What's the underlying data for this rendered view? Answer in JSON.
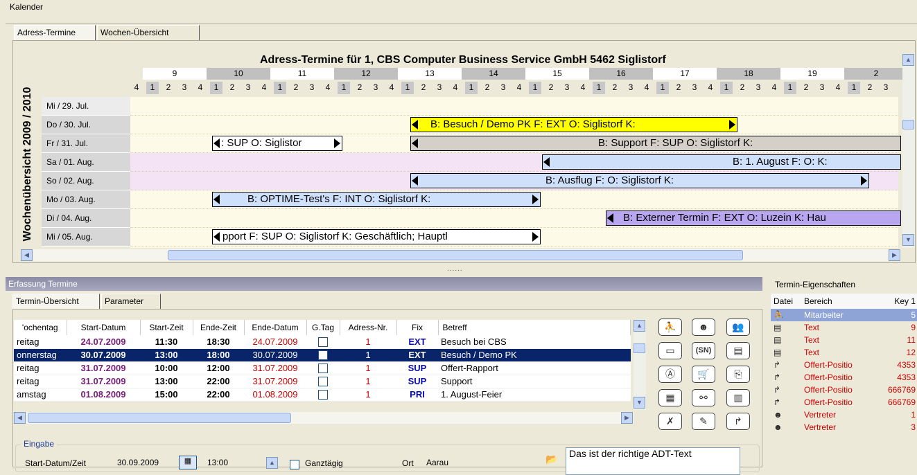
{
  "window": {
    "title": "Kalender"
  },
  "tabs": [
    {
      "label": "Adress-Termine"
    },
    {
      "label": "Wochen-Übersicht"
    }
  ],
  "calendar": {
    "title": "Adress-Termine für 1, CBS Computer Business Service GmbH  5462 Siglistorf",
    "year_label": "Wochenübersicht 2009 / 2010",
    "hours": [
      "9",
      "10",
      "11",
      "12",
      "13",
      "14",
      "15",
      "16",
      "17",
      "18",
      "19",
      "2"
    ],
    "days": [
      "Mi / 29. Jul.",
      "Do / 30. Jul.",
      "Fr / 31. Jul.",
      "Sa / 01. Aug.",
      "So / 02. Aug.",
      "Mo / 03. Aug.",
      "Di / 04. Aug.",
      "Mi / 05. Aug."
    ],
    "events": [
      {
        "text": "B: Besuch / Demo PK F: EXT O: Siglistorf K:",
        "color": "#ffff00"
      },
      {
        "text": ": SUP O: Siglistor",
        "color": "#ffffff"
      },
      {
        "text": "B: Support F: SUP O: Siglistorf K:",
        "color": "#d4d0c8"
      },
      {
        "text": "B: 1. August F:  O:  K:",
        "color": "#cfe0fb"
      },
      {
        "text": "B: Ausflug  F:  O: Siglistorf K:",
        "color": "#cfe0fb"
      },
      {
        "text": "B: OPTIME-Test's F: INT O: Siglistorf K:",
        "color": "#cfe0fb"
      },
      {
        "text": "B: Externer Termin F: EXT O: Luzein K: Hau",
        "color": "#b8a6f0"
      },
      {
        "text": "pport F: SUP O: Siglistorf K: Geschäftlich; Hauptl",
        "color": "#ffffff"
      }
    ]
  },
  "splitter": "......",
  "erfassung": {
    "title": "Erfassung Termine",
    "tabs": [
      {
        "label": "Termin-Übersicht"
      },
      {
        "label": "Parameter"
      }
    ],
    "columns": [
      "'ochentag",
      "Start-Datum",
      "Start-Zeit",
      "Ende-Zeit",
      "Ende-Datum",
      "G.Tag",
      "Adress-Nr.",
      "Fix",
      "Betreff"
    ],
    "rows": [
      {
        "day": "reitag",
        "start": "24.07.2009",
        "st": "11:30",
        "et": "18:30",
        "end": "24.07.2009",
        "nr": "1",
        "fix": "EXT",
        "betreff": "Besuch bei CBS"
      },
      {
        "day": "onnerstag",
        "start": "30.07.2009",
        "st": "13:00",
        "et": "18:00",
        "end": "30.07.2009",
        "nr": "1",
        "fix": "EXT",
        "betreff": "Besuch / Demo PK"
      },
      {
        "day": "reitag",
        "start": "31.07.2009",
        "st": "10:00",
        "et": "12:00",
        "end": "31.07.2009",
        "nr": "1",
        "fix": "SUP",
        "betreff": "Offert-Rapport"
      },
      {
        "day": "reitag",
        "start": "31.07.2009",
        "st": "13:00",
        "et": "22:00",
        "end": "31.07.2009",
        "nr": "1",
        "fix": "SUP",
        "betreff": "Support"
      },
      {
        "day": "amstag",
        "start": "01.08.2009",
        "st": "15:00",
        "et": "22:00",
        "end": "01.08.2009",
        "nr": "1",
        "fix": "PRI",
        "betreff": "1. August-Feier"
      }
    ],
    "eingabe": {
      "legend": "Eingabe",
      "start_label": "Start-Datum/Zeit",
      "start_date": "30.09.2009",
      "start_time": "13:00",
      "ganztaegig": "Ganztägig",
      "ort_label": "Ort",
      "ort": "Aarau",
      "note": "Das ist der richtige ADT-Text"
    }
  },
  "props": {
    "title": "Termin-Eigenschaften",
    "columns": [
      "Datei",
      "Bereich",
      "Key 1"
    ],
    "rows": [
      {
        "bereich": "Mitarbeiter",
        "key": "5"
      },
      {
        "bereich": "Text",
        "key": "9"
      },
      {
        "bereich": "Text",
        "key": "11"
      },
      {
        "bereich": "Text",
        "key": "12"
      },
      {
        "bereich": "Offert-Positio",
        "key": "4353"
      },
      {
        "bereich": "Offert-Positio",
        "key": "4353"
      },
      {
        "bereich": "Offert-Positio",
        "key": "666769"
      },
      {
        "bereich": "Offert-Positio",
        "key": "666769"
      },
      {
        "bereich": "Vertreter",
        "key": "1"
      },
      {
        "bereich": "Vertreter",
        "key": "3"
      }
    ]
  }
}
